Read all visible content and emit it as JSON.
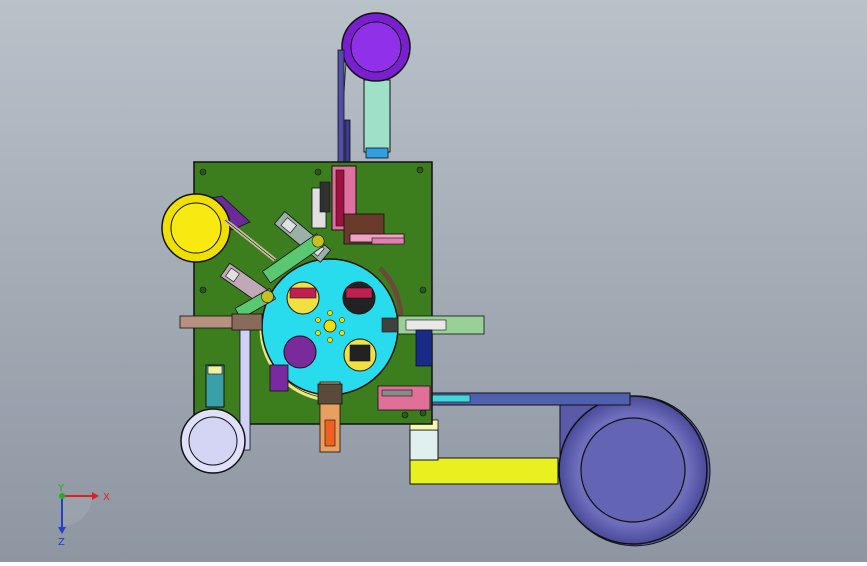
{
  "viewport": {
    "background_top": "#b8c0c8",
    "background_bottom": "#8e97a2"
  },
  "colors": {
    "baseplate": "#3d7f1f",
    "rotary_table": "#2ee0f0",
    "bowl_yellow": "#f2e200",
    "bowl_purple": "#8a2be2",
    "bowl_lavender": "#d8d8f8",
    "bowl_blue": "#6a6ab8",
    "track_steel": "#4a5aa8",
    "track_yellow": "#e6f020",
    "track_cyan": "#9fe0e0"
  },
  "triad": {
    "x_label": "X",
    "y_label": "Y",
    "z_label": "Z",
    "x_color": "#e02020",
    "y_color": "#20b020",
    "z_color": "#2040d0"
  }
}
